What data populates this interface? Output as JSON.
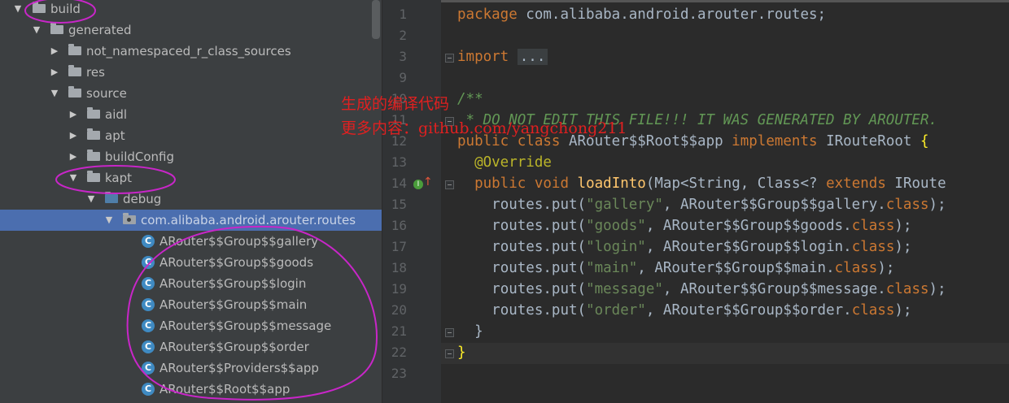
{
  "project_tree": {
    "items": [
      {
        "label": "build",
        "expanded": true,
        "icon": "folder-icon"
      },
      {
        "label": "generated",
        "expanded": true,
        "icon": "folder-icon"
      },
      {
        "label": "not_namespaced_r_class_sources",
        "expanded": false,
        "icon": "folder-icon"
      },
      {
        "label": "res",
        "expanded": false,
        "icon": "folder-icon"
      },
      {
        "label": "source",
        "expanded": true,
        "icon": "folder-icon"
      },
      {
        "label": "aidl",
        "expanded": false,
        "icon": "folder-icon"
      },
      {
        "label": "apt",
        "expanded": false,
        "icon": "folder-icon"
      },
      {
        "label": "buildConfig",
        "expanded": false,
        "icon": "folder-icon"
      },
      {
        "label": "kapt",
        "expanded": true,
        "icon": "folder-icon"
      },
      {
        "label": "debug",
        "expanded": true,
        "icon": "source-folder-icon"
      },
      {
        "label": "com.alibaba.android.arouter.routes",
        "expanded": true,
        "icon": "package-icon",
        "selected": true
      },
      {
        "label": "ARouter$$Group$$gallery",
        "icon": "class-icon"
      },
      {
        "label": "ARouter$$Group$$goods",
        "icon": "class-icon"
      },
      {
        "label": "ARouter$$Group$$login",
        "icon": "class-icon"
      },
      {
        "label": "ARouter$$Group$$main",
        "icon": "class-icon"
      },
      {
        "label": "ARouter$$Group$$message",
        "icon": "class-icon"
      },
      {
        "label": "ARouter$$Group$$order",
        "icon": "class-icon"
      },
      {
        "label": "ARouter$$Providers$$app",
        "icon": "class-icon"
      },
      {
        "label": "ARouter$$Root$$app",
        "icon": "class-icon"
      }
    ],
    "class_icon_letter": "C"
  },
  "editor": {
    "line_numbers": [
      "1",
      "2",
      "3",
      "9",
      "10",
      "11",
      "12",
      "13",
      "14",
      "15",
      "16",
      "17",
      "18",
      "19",
      "20",
      "21",
      "22",
      "23"
    ],
    "tokens": {
      "package_kw": "package",
      "package_name": " com.alibaba.android.arouter.routes;",
      "import_kw": "import",
      "import_fold": "...",
      "doc_open": "/**",
      "doc_line": " * DO NOT EDIT THIS FILE!!! IT WAS GENERATED BY AROUTER.",
      "public_kw": "public",
      "class_kw": "class",
      "class_name": " ARouter$$Root$$app ",
      "implements_kw": "implements",
      "iface": " IRouteRoot ",
      "open_brace": "{",
      "annotation": "@Override",
      "void_kw": "void",
      "method": "loadInto",
      "sig_a": "(Map<String, Class<? ",
      "extends_kw": "extends",
      "sig_b": " IRoute",
      "put_prefix": "routes.put(",
      "sep": ", ",
      "dot": ".",
      "class_lit": "class",
      "close": ");",
      "close_method": "}",
      "close_class": "}"
    },
    "routes": [
      {
        "name": "\"gallery\"",
        "group": "ARouter$$Group$$gallery"
      },
      {
        "name": "\"goods\"",
        "group": "ARouter$$Group$$goods"
      },
      {
        "name": "\"login\"",
        "group": "ARouter$$Group$$login"
      },
      {
        "name": "\"main\"",
        "group": "ARouter$$Group$$main"
      },
      {
        "name": "\"message\"",
        "group": "ARouter$$Group$$message"
      },
      {
        "name": "\"order\"",
        "group": "ARouter$$Group$$order"
      }
    ],
    "gutter_badge": "I",
    "gutter_arrow": "↑"
  },
  "overlay": {
    "line1": "生成的编译代码",
    "line2": "更多内容：github.com/yangchong211"
  },
  "colors": {
    "tree_bg": "#3c3f41",
    "selection": "#4b6eaf",
    "editor_bg": "#2b2b2b",
    "keyword": "#cc7832",
    "string": "#6a8759",
    "annotation": "#bbb529",
    "function": "#ffc66d",
    "comment": "#629755",
    "overlay_text": "#e02020",
    "ink": "#c826c8"
  }
}
